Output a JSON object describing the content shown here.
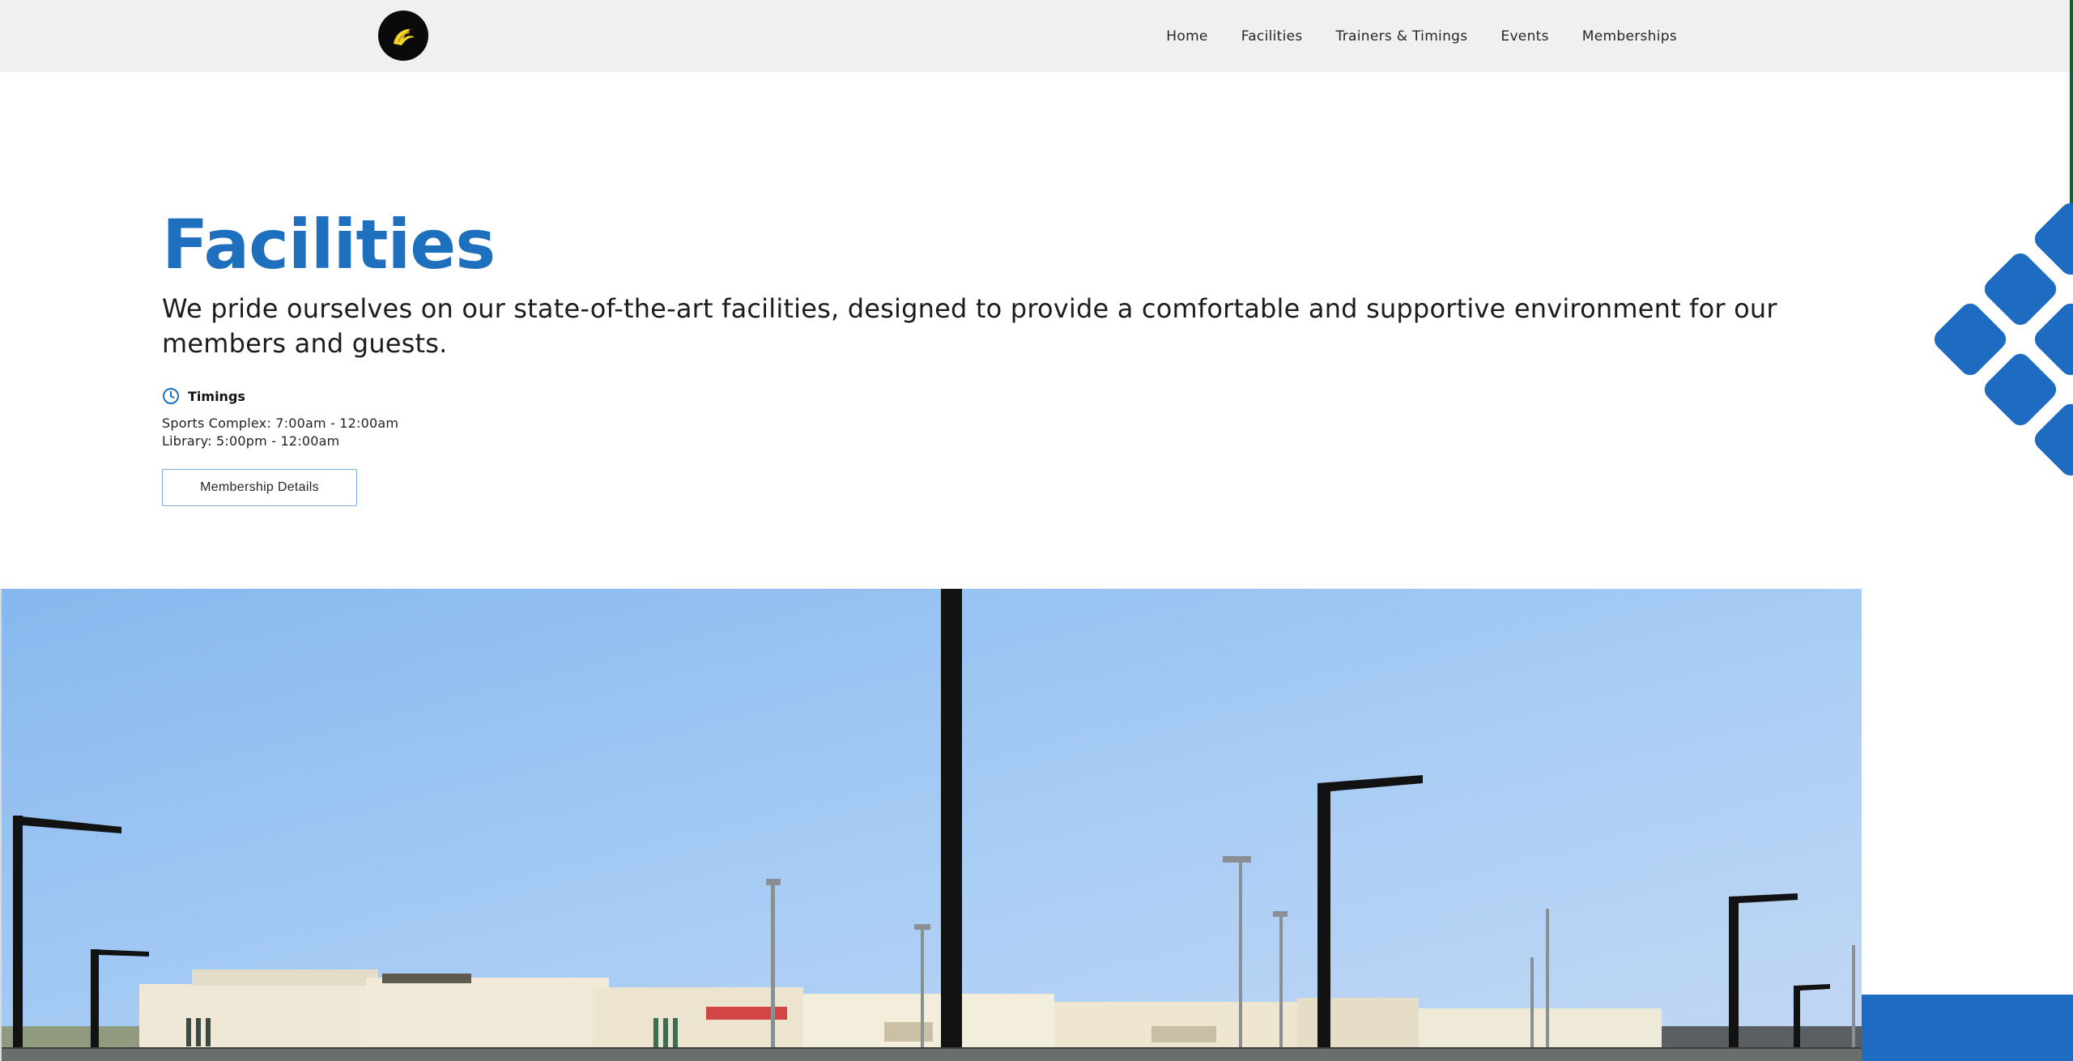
{
  "nav": {
    "items": [
      {
        "label": "Home"
      },
      {
        "label": "Facilities"
      },
      {
        "label": "Trainers & Timings"
      },
      {
        "label": "Events"
      },
      {
        "label": "Memberships"
      }
    ]
  },
  "hero": {
    "title": "Facilities",
    "description": "We pride ourselves on our state-of-the-art facilities, designed to provide a comfortable and supportive environment for our members and guests.",
    "timings_heading": "Timings",
    "timings": [
      "Sports Complex: 7:00am - 12:00am",
      "Library: 5:00pm - 12:00am"
    ],
    "cta_label": "Membership Details"
  },
  "colors": {
    "accent": "#1f6fbf",
    "nav_bg": "#eff1f0",
    "diamond": "#1d6cc2"
  },
  "icons": [
    "logo-icon",
    "clock-icon"
  ]
}
